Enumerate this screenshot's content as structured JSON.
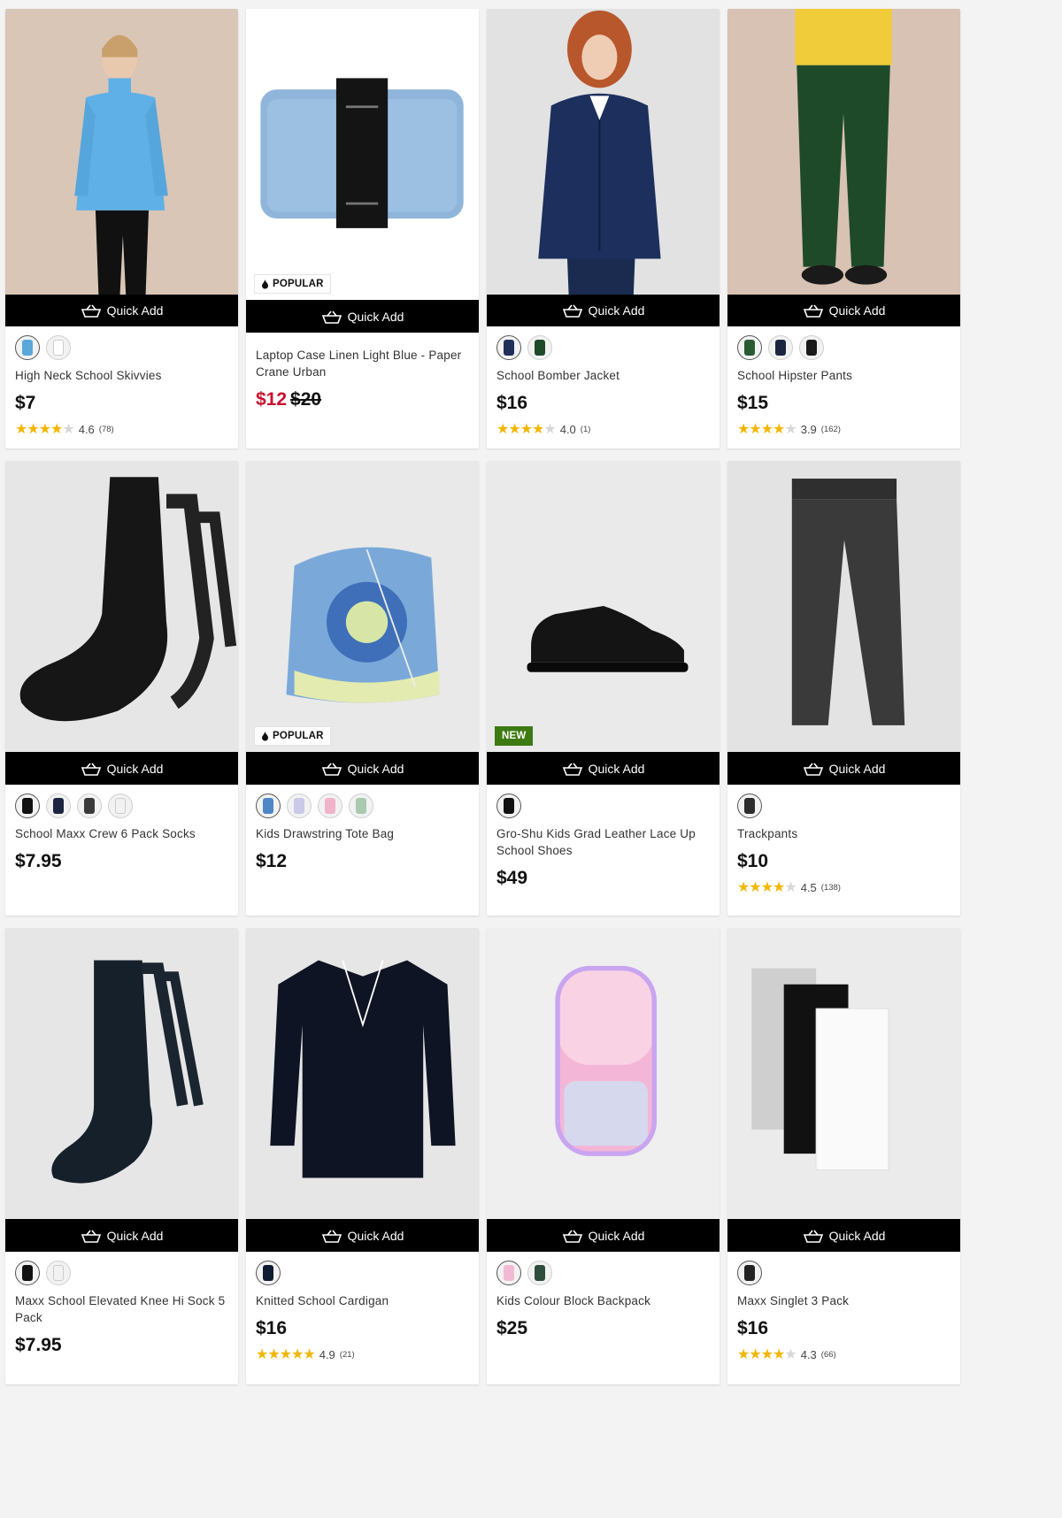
{
  "quick_add_label": "Quick Add",
  "products": [
    {
      "name": "High Neck School Skivvies",
      "price": "$7",
      "rating": "4.6",
      "count": "(78)",
      "stars": 4.6,
      "swatches": [
        "#5aa7d9",
        "#ffffff"
      ],
      "badge": "",
      "bg": "#d7c3b3"
    },
    {
      "name": "Laptop Case Linen Light Blue - Paper Crane Urban",
      "price_sale": "$12",
      "price_was": "$20",
      "badge": "POPULAR",
      "bg": "#ffffff"
    },
    {
      "name": "School Bomber Jacket",
      "price": "$16",
      "rating": "4.0",
      "count": "(1)",
      "stars": 4.0,
      "swatches": [
        "#1e2f5a",
        "#1f4a2a"
      ],
      "badge": "",
      "bg": "#dfdfdf"
    },
    {
      "name": "School Hipster Pants",
      "price": "$15",
      "rating": "3.9",
      "count": "(162)",
      "stars": 3.9,
      "swatches": [
        "#2a5a34",
        "#1c2540",
        "#1b1b1b"
      ],
      "badge": "",
      "bg": "#d8c1b2"
    },
    {
      "name": "School Maxx Crew 6 Pack Socks",
      "price": "$7.95",
      "swatches": [
        "#111111",
        "#1c2540",
        "#3a3a3a",
        "#f2f2f2"
      ],
      "badge": "",
      "bg": "#e4e4e4"
    },
    {
      "name": "Kids Drawstring Tote Bag",
      "price": "$12",
      "swatches": [
        "#4f86c6",
        "#c9c9e8",
        "#f0b3c9",
        "#a9c9b0"
      ],
      "badge": "POPULAR",
      "bg": "#e7e7e7"
    },
    {
      "name": "Gro-Shu Kids Grad Leather Lace Up School Shoes",
      "price": "$49",
      "swatches": [
        "#111111"
      ],
      "badge": "NEW",
      "bg": "#e8e8e8"
    },
    {
      "name": "Trackpants",
      "price": "$10",
      "rating": "4.5",
      "count": "(138)",
      "stars": 4.5,
      "swatches": [
        "#2d2d2d"
      ],
      "badge": "",
      "bg": "#e3e3e3"
    },
    {
      "name": "Maxx School Elevated Knee Hi Sock 5 Pack",
      "price": "$7.95",
      "swatches": [
        "#111111",
        "#f2f2f2"
      ],
      "badge": "",
      "bg": "#e6e6e6"
    },
    {
      "name": "Knitted School Cardigan",
      "price": "$16",
      "rating": "4.9",
      "count": "(21)",
      "stars": 4.9,
      "swatches": [
        "#0f1a33"
      ],
      "badge": "",
      "bg": "#e5e5e5"
    },
    {
      "name": "Kids Colour Block Backpack",
      "price": "$25",
      "swatches": [
        "#f3b9d4",
        "#2e4d3a"
      ],
      "badge": "",
      "bg": "#ededed"
    },
    {
      "name": "Maxx Singlet 3 Pack",
      "price": "$16",
      "rating": "4.3",
      "count": "(66)",
      "stars": 4.3,
      "swatches": [
        "#222222"
      ],
      "badge": "",
      "bg": "#e8e8e8"
    }
  ]
}
